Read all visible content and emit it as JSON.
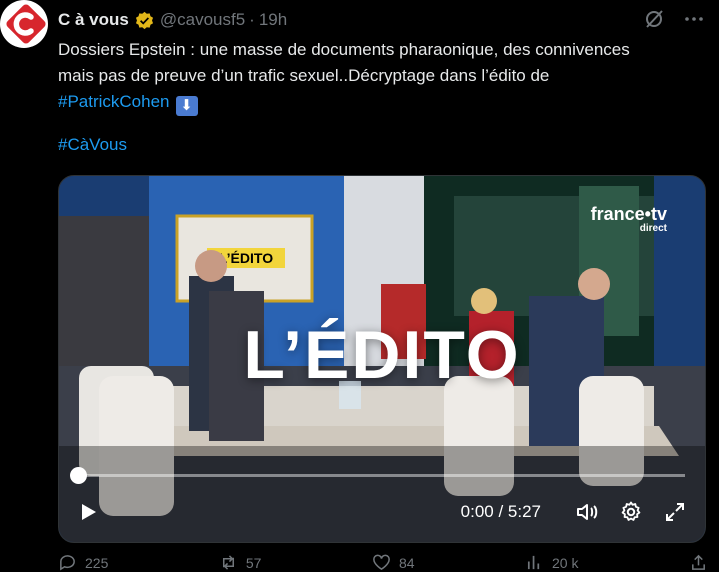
{
  "tweet": {
    "author_name": "C à vous",
    "handle": "@cavousf5",
    "separator": "·",
    "time": "19h",
    "text_line1": "Dossiers Epstein : une masse de documents pharaonique, des connivences",
    "text_line2": "mais pas de preuve d’un trafic sexuel..Décryptage dans l’édito de",
    "hashtag1": "#PatrickCohen",
    "hashtag2": "#CàVous",
    "emoji_label": "⬇"
  },
  "video": {
    "overlay_title": "L’ÉDITO",
    "screen_label": "L’ÉDITO",
    "channel_logo": "france•tv",
    "channel_sub": "direct",
    "time_readout": "0:00 / 5:27",
    "progress_fraction": 0.0
  },
  "actions": {
    "replies": "225",
    "reposts": "57",
    "likes": "84",
    "views": "20 k"
  },
  "colors": {
    "background": "#000000",
    "text": "#e7e9ea",
    "muted": "#71767b",
    "link": "#1d9bf0",
    "avatar_red": "#d7262d"
  }
}
